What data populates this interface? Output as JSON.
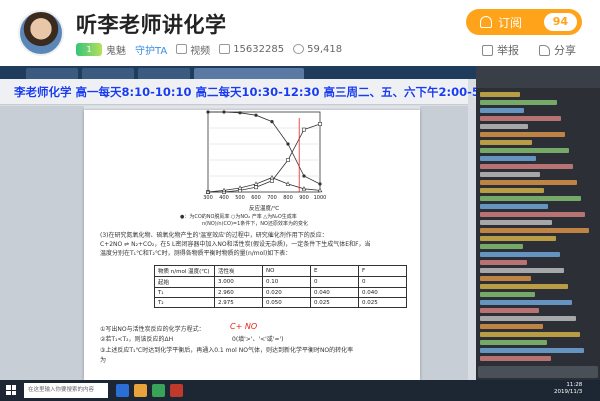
{
  "channel": {
    "title": "听李老师讲化学",
    "level_badge": "1",
    "user_name": "鬼魅",
    "guard_label": "守护TA",
    "video_label": "视频",
    "room_id": "15632285",
    "followers": "59,418"
  },
  "actions": {
    "subscribe_label": "订阅",
    "subscribe_count": "94",
    "report_label": "举报",
    "share_label": "分享"
  },
  "video": {
    "ticker": "李老师化学  高一每天8:10-10:10  高二每天10:30-12:30  高三周二、五、六下午2:00-5:00",
    "chart_caption": "●：为CO的NO脱氮率 ○为NO₂ 产率 △为N₂O生成率",
    "chart_caption2": "n(NO)/n(CO)=1条件下，NO还原效率为的变化",
    "chart_xlabel": "反应温度/℃",
    "question_3": "(3)在研究氮氧化物、硫氧化物产生的'温室效应'的过程中，研究催化剂作用下的反应：",
    "question_3b": "C+2NO ⇌ N₂+CO₂，在5 L密闭容器中加入NO和活性炭(假设无杂质)，一定条件下生成气体E和F，当",
    "question_3c": "温度分别在T₁℃和T₂℃时，测得各物质平衡时物质的量(n/mol)如下表：",
    "table": [
      [
        "物质 n/mol 温度(℃)",
        "活性炭",
        "NO",
        "E",
        "F"
      ],
      [
        "起始",
        "3.000",
        "0.10",
        "0",
        "0"
      ],
      [
        "T₁",
        "2.960",
        "0.020",
        "0.040",
        "0.040"
      ],
      [
        "T₂",
        "2.975",
        "0.050",
        "0.025",
        "0.025"
      ]
    ],
    "q_1": "①写出NO与活性炭反应的化学方程式：",
    "q_1_ans": "C+ NO",
    "q_2": "②若T₁<T₂，则该反应的ΔH",
    "q_2b": "0(填'>'、'<'或'=')",
    "q_3": "③上述反应T₁℃时达到化学平衡后，再通入0.1 mol NO气体，则达到新化学平衡时NO的转化率",
    "q_3b": "为",
    "taskbar_search": "在这里输入你要搜索的内容",
    "taskbar_time": "11:28",
    "taskbar_date": "2019/11/3"
  },
  "chart_data": {
    "type": "line",
    "x": [
      300,
      400,
      500,
      600,
      700,
      800,
      900,
      1000
    ],
    "xlim": [
      300,
      1000
    ],
    "xlabel": "反应温度/℃",
    "series": [
      {
        "values": [
          100,
          100,
          99,
          96,
          88,
          60,
          20,
          10
        ]
      },
      {
        "values": [
          0,
          0,
          2,
          6,
          14,
          40,
          78,
          85
        ]
      },
      {
        "values": [
          0,
          2,
          5,
          10,
          18,
          10,
          4,
          2
        ]
      }
    ],
    "ylim": [
      0,
      100
    ],
    "marker_x": 870
  },
  "colors": {
    "accent_orange": "#ffa31a",
    "ticker_blue": "#1a3cf0",
    "handwrite_red": "#e0261d"
  },
  "icons": [
    "level-badge-icon",
    "video-icon",
    "room-id-icon",
    "followers-icon",
    "bell-icon",
    "report-icon",
    "share-icon",
    "windows-start-icon"
  ]
}
